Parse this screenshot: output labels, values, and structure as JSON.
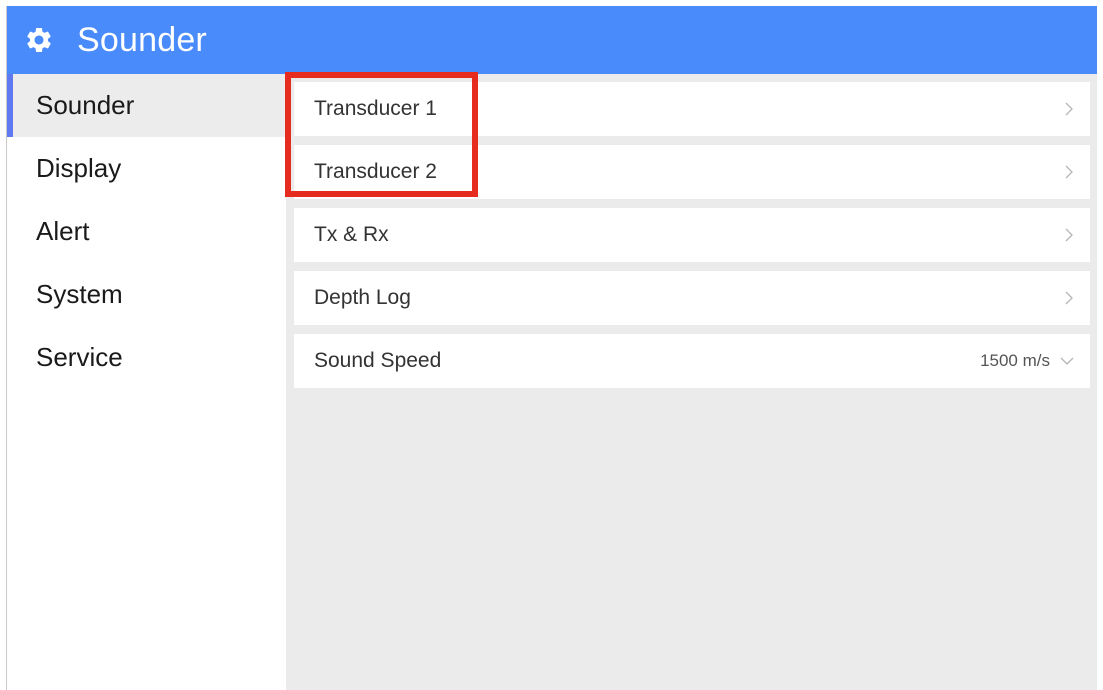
{
  "header": {
    "title": "Sounder",
    "icon": "gear-icon"
  },
  "sidebar": {
    "items": [
      {
        "label": "Sounder",
        "active": true
      },
      {
        "label": "Display"
      },
      {
        "label": "Alert"
      },
      {
        "label": "System"
      },
      {
        "label": "Service"
      }
    ]
  },
  "settings": {
    "rows": [
      {
        "label": "Transducer 1",
        "icon": "chevron-right-icon"
      },
      {
        "label": "Transducer 2",
        "icon": "chevron-right-icon"
      },
      {
        "label": "Tx & Rx",
        "icon": "chevron-right-icon"
      },
      {
        "label": "Depth Log",
        "icon": "chevron-right-icon"
      },
      {
        "label": "Sound Speed",
        "value": "1500 m/s",
        "icon": "chevron-down-icon"
      }
    ]
  },
  "colors": {
    "header_bg": "#4a8bfb",
    "active_indicator": "#5f7af0",
    "highlight_box": "#e62c1e"
  }
}
